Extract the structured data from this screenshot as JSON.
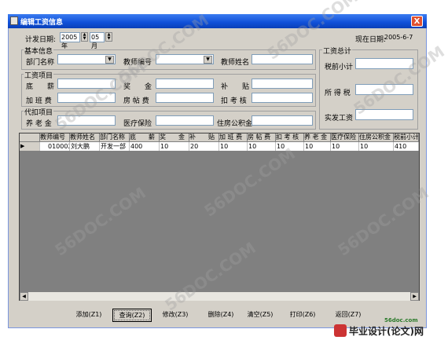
{
  "window": {
    "title": "编辑工资信息",
    "close_label": "X"
  },
  "header": {
    "date_label": "计发日期:",
    "year": "2005年",
    "month": "05月",
    "current_date_label": "现在日期:",
    "current_date": "2005-6-7"
  },
  "basic_info": {
    "group_title": "基本信息",
    "dept_label": "部门名称",
    "teacher_id_label": "教师编号",
    "teacher_name_label": "教师姓名"
  },
  "salary_items": {
    "group_title": "工资项目",
    "base_label": "底　　薪",
    "bonus_label": "奖　　金",
    "subsidy_label": "补　　贴",
    "overtime_label": "加 班 费",
    "housing_label": "房 帖 费",
    "deduct_label": "扣 考 核"
  },
  "withholding": {
    "group_title": "代扣项目",
    "pension_label": "养 老 金",
    "medical_label": "医疗保险",
    "housing_fund_label": "住房公积金"
  },
  "totals": {
    "group_title": "工资总计",
    "pretax_label": "税前小计",
    "tax_label": "所 得 税",
    "net_label": "实发工资"
  },
  "table": {
    "columns": [
      "教师编号",
      "教师姓名",
      "部门名称",
      "底　　薪",
      "奖　　金",
      "补　　贴",
      "加 班 费",
      "房 帖 费",
      "扣 考 核",
      "养 老 金",
      "医疗保险",
      "住房公积金",
      "税前小计"
    ],
    "rows": [
      [
        "010002",
        "刘大鹏",
        "开发一部",
        "400",
        "10",
        "20",
        "10",
        "10",
        "10",
        "10",
        "10",
        "10",
        "410"
      ]
    ]
  },
  "buttons": {
    "add": "添加(Z1)",
    "query": "查询(Z2)",
    "edit": "修改(Z3)",
    "delete": "删除(Z4)",
    "clear": "清空(Z5)",
    "print": "打印(Z6)",
    "back": "返回(Z7)"
  },
  "watermark": {
    "text": "56DOC.COM",
    "brand_url": "56doc.com",
    "brand_name": "毕业设计(论文)网"
  },
  "colors": {
    "titlebar": "#1050d8",
    "window_bg": "#d4d0c8",
    "grid_bg": "#808080",
    "close": "#e0502f"
  }
}
